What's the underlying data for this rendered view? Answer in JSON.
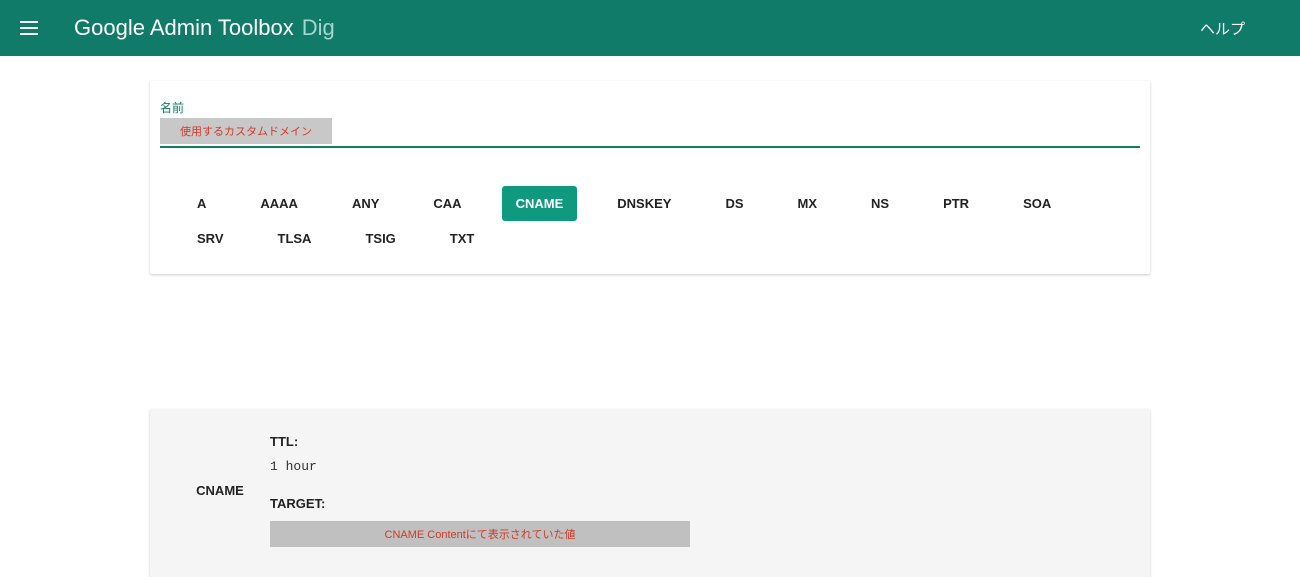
{
  "header": {
    "title": "Google Admin Toolbox",
    "subtitle": "Dig",
    "help": "ヘルプ"
  },
  "query": {
    "name_label": "名前",
    "domain_annotation": "使用するカスタムドメイン",
    "record_types": [
      "A",
      "AAAA",
      "ANY",
      "CAA",
      "CNAME",
      "DNSKEY",
      "DS",
      "MX",
      "NS",
      "PTR",
      "SOA",
      "SRV",
      "TLSA",
      "TSIG",
      "TXT"
    ],
    "active_type": "CNAME"
  },
  "result": {
    "record_type": "CNAME",
    "ttl_label": "TTL:",
    "ttl_value": "1 hour",
    "target_label": "TARGET:",
    "target_annotation": "CNAME Contentにて表示されていた値"
  }
}
